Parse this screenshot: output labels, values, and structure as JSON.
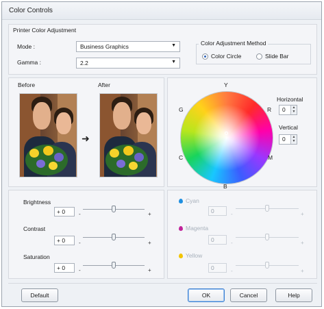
{
  "window": {
    "title": "Color Controls"
  },
  "printer_adjustment": {
    "section_label": "Printer Color Adjustment",
    "mode_label": "Mode :",
    "mode_value": "Business Graphics",
    "gamma_label": "Gamma :",
    "gamma_value": "2.2"
  },
  "method": {
    "legend": "Color Adjustment Method",
    "options": [
      {
        "label": "Color Circle",
        "selected": true
      },
      {
        "label": "Slide Bar",
        "selected": false
      }
    ]
  },
  "preview": {
    "before_label": "Before",
    "after_label": "After",
    "arrow": "➜"
  },
  "color_circle": {
    "labels": {
      "top": "Y",
      "top_right": "R",
      "right": "M",
      "bottom": "B",
      "left": "C",
      "top_left": "G"
    },
    "horizontal_label": "Horizontal",
    "horizontal_value": "0",
    "vertical_label": "Vertical",
    "vertical_value": "0"
  },
  "adjustments": [
    {
      "label": "Brightness",
      "value": "+ 0",
      "minus": "-",
      "plus": "+",
      "level": 0.5
    },
    {
      "label": "Contrast",
      "value": "+ 0",
      "minus": "-",
      "plus": "+",
      "level": 0.5
    },
    {
      "label": "Saturation",
      "value": "+ 0",
      "minus": "-",
      "plus": "+",
      "level": 0.5
    }
  ],
  "color_adjustments": [
    {
      "label": "Cyan",
      "value": "0",
      "minus": "-",
      "plus": "+",
      "level": 0.5,
      "color": "#1f8fe0"
    },
    {
      "label": "Magenta",
      "value": "0",
      "minus": "-",
      "plus": "+",
      "level": 0.5,
      "color": "#c0249a"
    },
    {
      "label": "Yellow",
      "value": "0",
      "minus": "-",
      "plus": "+",
      "level": 0.5,
      "color": "#f2c400"
    }
  ],
  "buttons": {
    "default_label": "Default",
    "ok_label": "OK",
    "cancel_label": "Cancel",
    "help_label": "Help"
  }
}
